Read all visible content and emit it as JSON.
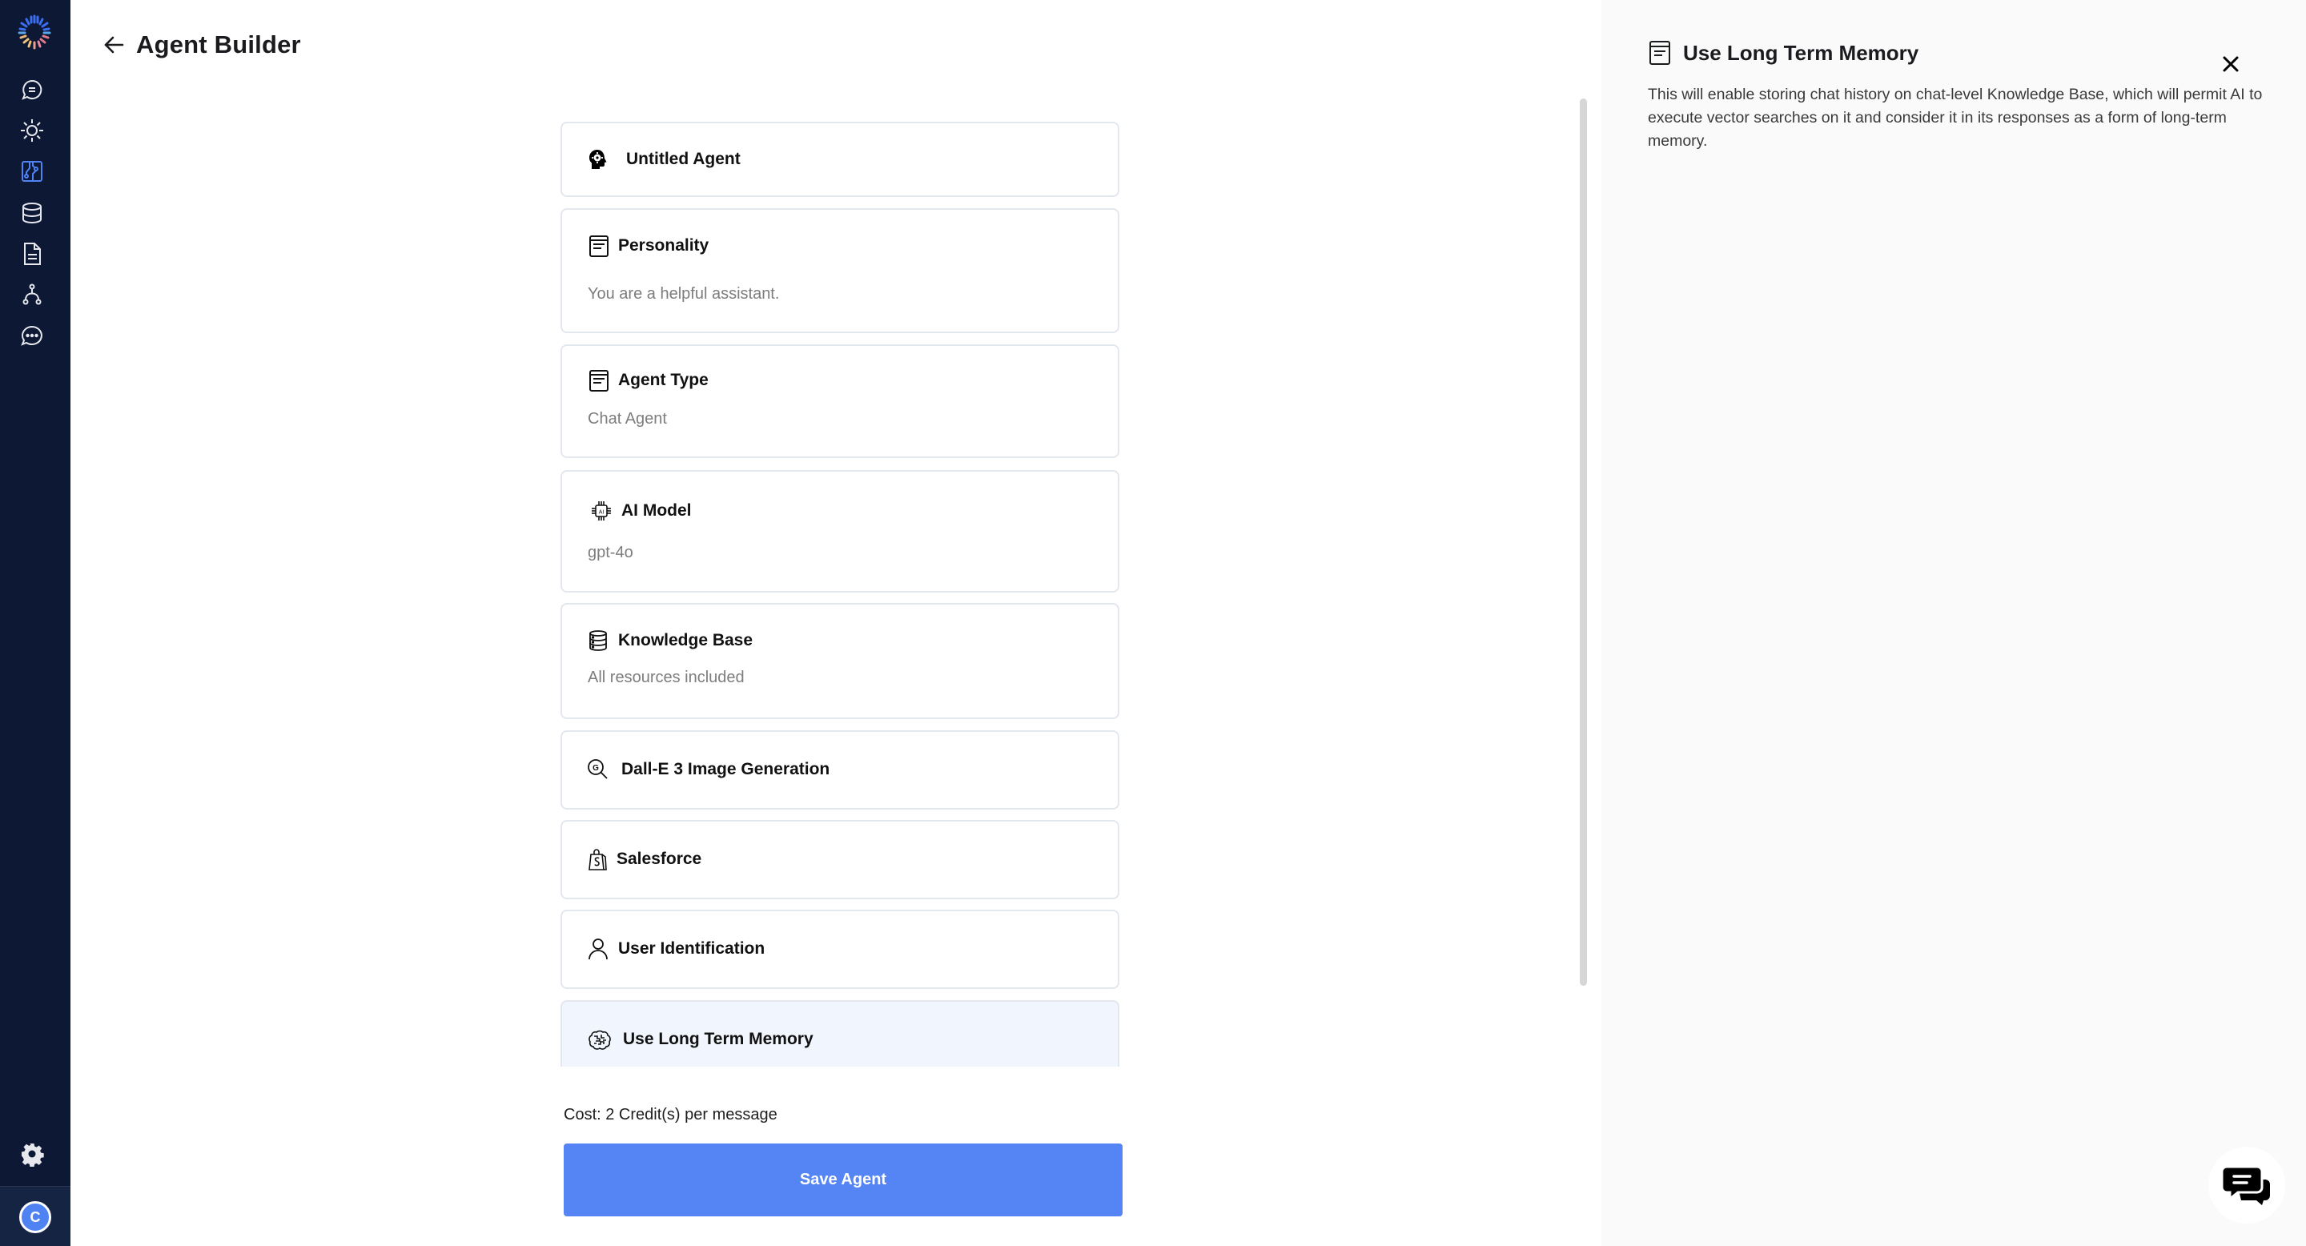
{
  "colors": {
    "sidebar_bg": "#0d1834",
    "accent": "#5584f5",
    "active_nav": "#4f82f2",
    "selected_card_bg": "#f1f5fe"
  },
  "sidebar": {
    "logo": "app-logo",
    "items": [
      {
        "icon": "chat-bubble-icon",
        "active": false
      },
      {
        "icon": "sun-icon",
        "active": false
      },
      {
        "icon": "circuit-board-icon",
        "active": true
      },
      {
        "icon": "database-icon",
        "active": false
      },
      {
        "icon": "document-icon",
        "active": false
      },
      {
        "icon": "workflow-icon",
        "active": false
      },
      {
        "icon": "chat-dots-icon",
        "active": false
      }
    ],
    "settings_icon": "gear-icon",
    "avatar_initial": "C"
  },
  "header": {
    "back_icon": "arrow-left-icon",
    "title": "Agent Builder"
  },
  "cards": [
    {
      "icon": "head-gear-icon",
      "title": "Untitled Agent",
      "value": null
    },
    {
      "icon": "document-lines-icon",
      "title": "Personality",
      "value": "You are a helpful assistant."
    },
    {
      "icon": "document-lines-icon",
      "title": "Agent Type",
      "value": "Chat Agent"
    },
    {
      "icon": "ai-chip-icon",
      "title": "AI Model",
      "value": "gpt-4o"
    },
    {
      "icon": "database-stack-icon",
      "title": "Knowledge Base",
      "value": "All resources included"
    },
    {
      "icon": "search-g-icon",
      "title": "Dall-E 3 Image Generation",
      "value": null
    },
    {
      "icon": "shopping-bag-icon",
      "title": "Salesforce",
      "value": null
    },
    {
      "icon": "user-icon",
      "title": "User Identification",
      "value": null
    },
    {
      "icon": "brain-icon",
      "title": "Use Long Term Memory",
      "value": null,
      "selected": true
    }
  ],
  "footer": {
    "cost": "Cost: 2 Credit(s) per message",
    "save_label": "Save Agent"
  },
  "panel": {
    "icon": "document-lines-icon",
    "title": "Use Long Term Memory",
    "description": "This will enable storing chat history on chat-level Knowledge Base, which will permit AI to execute vector searches on it and consider it in its responses as a form of long-term memory.",
    "close_icon": "close-icon"
  },
  "chat_widget": {
    "icon": "chat-support-icon"
  }
}
